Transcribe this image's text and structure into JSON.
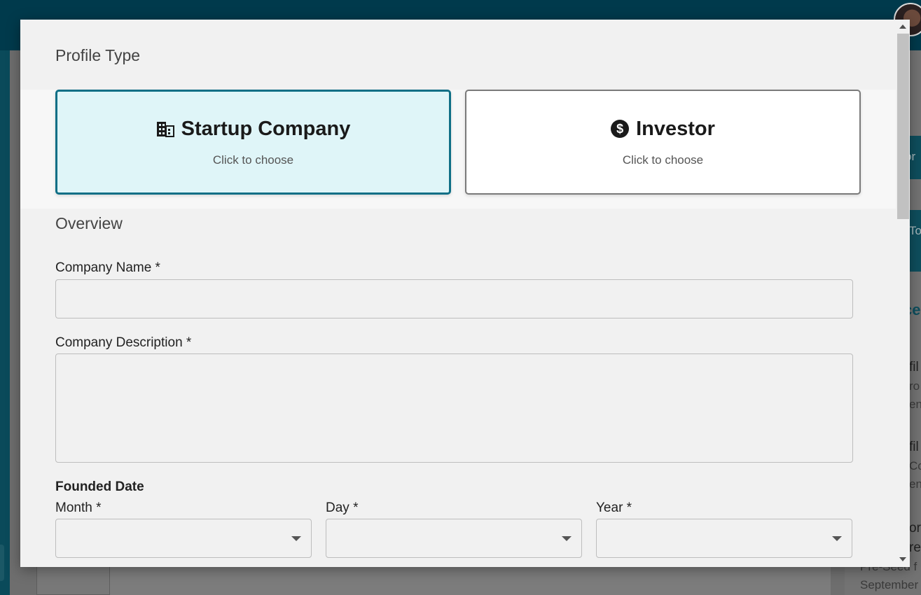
{
  "background": {
    "right_panel_fragments": [
      "or",
      "To",
      "ce",
      "fil",
      "ro",
      "en",
      "fil",
      "Co",
      "en",
      "orp",
      "re",
      "Pre-Seed f",
      "September"
    ]
  },
  "modal": {
    "profile_type_title": "Profile Type",
    "profile_options": [
      {
        "title": "Startup Company",
        "subtitle": "Click to choose",
        "icon": "building-icon",
        "selected": true
      },
      {
        "title": "Investor",
        "subtitle": "Click to choose",
        "icon": "dollar-circle-icon",
        "selected": false
      }
    ],
    "overview_title": "Overview",
    "company_name": {
      "label": "Company Name *",
      "value": "",
      "placeholder": ""
    },
    "company_description": {
      "label": "Company Description *",
      "value": "",
      "placeholder": ""
    },
    "founded_date": {
      "heading": "Founded Date",
      "month_label": "Month *",
      "day_label": "Day *",
      "year_label": "Year *",
      "month_value": "",
      "day_value": "",
      "year_value": ""
    }
  },
  "colors": {
    "selected_border": "#0e6f86",
    "selected_fill": "#dff5f8",
    "topbar": "#003a4c"
  }
}
